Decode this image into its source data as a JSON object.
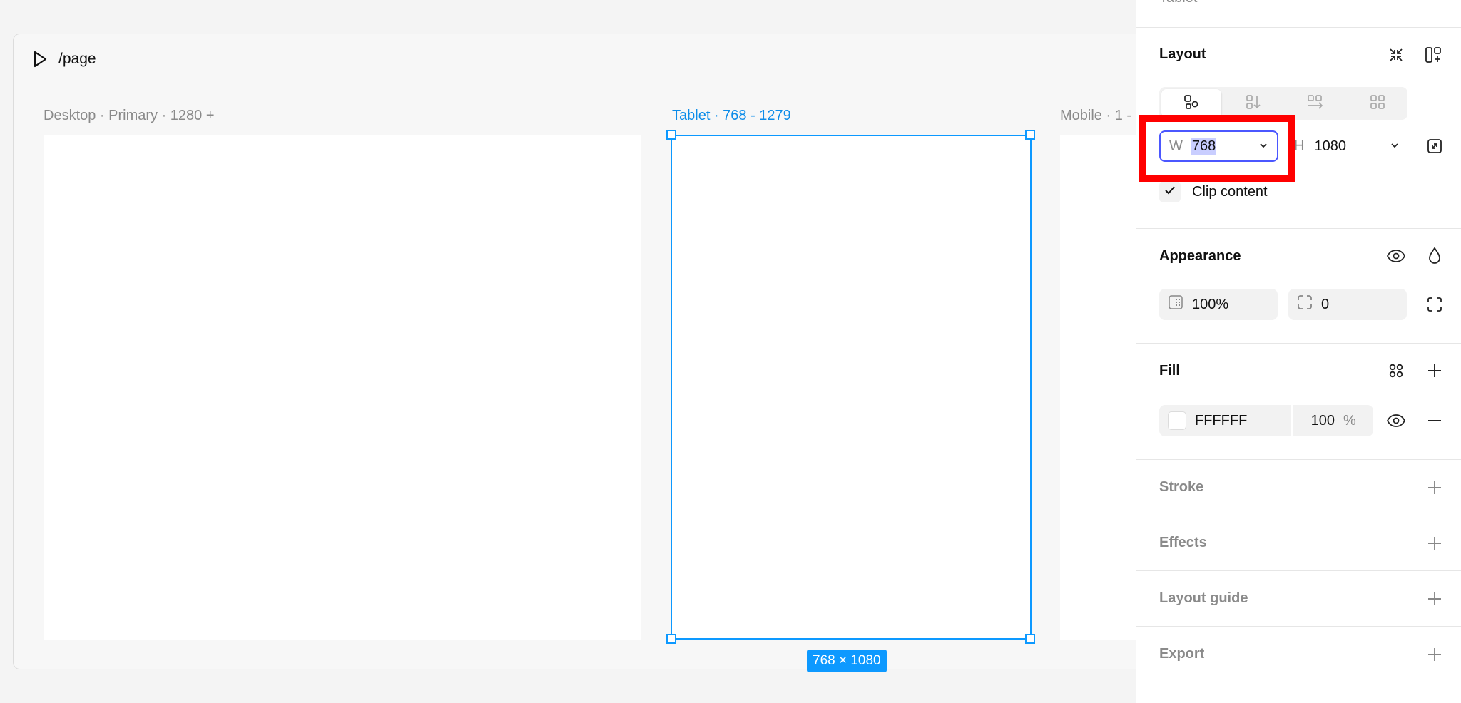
{
  "canvas": {
    "route": "/page",
    "frames": [
      {
        "label": "Desktop · Primary · 1280 +"
      },
      {
        "label": "Tablet · 768 - 1279"
      },
      {
        "label": "Mobile · 1 -"
      }
    ],
    "size_badge": "768 × 1080"
  },
  "panel": {
    "top_title": "Tablet",
    "layout": {
      "title": "Layout",
      "width_label": "W",
      "width_value": "768",
      "height_label": "H",
      "height_value": "1080",
      "clip_content": "Clip content"
    },
    "appearance": {
      "title": "Appearance",
      "opacity": "100%",
      "radius": "0"
    },
    "fill": {
      "title": "Fill",
      "color_hex": "FFFFFF",
      "opacity": "100",
      "opacity_unit": "%"
    },
    "stroke": {
      "title": "Stroke"
    },
    "effects": {
      "title": "Effects"
    },
    "layout_guide": {
      "title": "Layout guide"
    },
    "export": {
      "title": "Export"
    }
  },
  "colors": {
    "accent": "#0d99ff",
    "highlight": "#ff0000",
    "fill_swatch": "#ffffff"
  }
}
